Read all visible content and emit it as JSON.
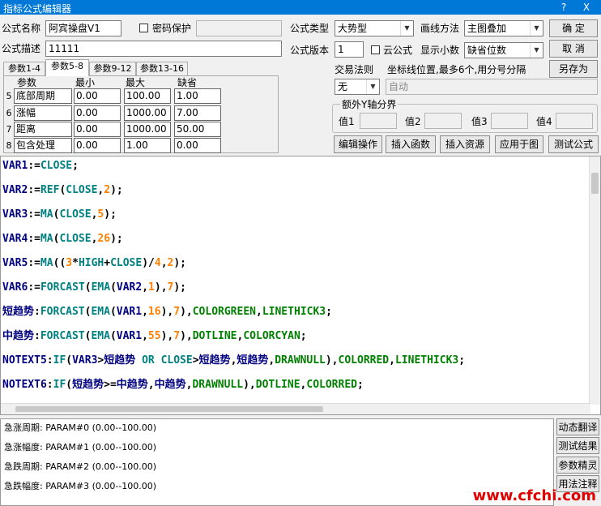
{
  "window": {
    "title": "指标公式编辑器",
    "help_btn": "?",
    "close_btn": "X"
  },
  "form": {
    "name_label": "公式名称",
    "name_value": "阿宾操盘V1",
    "password_label": "密码保护",
    "desc_label": "公式描述",
    "desc_value": "11111",
    "type_label": "公式类型",
    "type_value": "大势型",
    "draw_label": "画线方法",
    "draw_value": "主图叠加",
    "version_label": "公式版本",
    "version_value": "1",
    "cloud_label": "云公式",
    "decimals_label": "显示小数",
    "decimals_value": "缺省位数",
    "trade_label": "交易法则",
    "trade_value": "无",
    "axis_hint": "坐标线位置,最多6个,用分号分隔",
    "axis_value": "自动",
    "extra_y_label": "额外Y轴分界",
    "val1": "值1",
    "val2": "值2",
    "val3": "值3",
    "val4": "值4"
  },
  "buttons": {
    "ok": "确  定",
    "cancel": "取  消",
    "save_as": "另存为",
    "edit_ops": "编辑操作",
    "insert_func": "插入函数",
    "insert_res": "插入资源",
    "apply_chart": "应用于图",
    "test_formula": "测试公式",
    "dyn_translate": "动态翻译",
    "test_result": "测试结果",
    "param_wizard": "参数精灵",
    "usage_notes": "用法注释"
  },
  "tabs": [
    "参数1-4",
    "参数5-8",
    "参数9-12",
    "参数13-16"
  ],
  "params": {
    "headers": [
      "参数",
      "最小",
      "最大",
      "缺省"
    ],
    "rows": [
      {
        "no": "5",
        "name": "底部周期",
        "min": "0.00",
        "max": "100.00",
        "def": "1.00"
      },
      {
        "no": "6",
        "name": "涨幅",
        "min": "0.00",
        "max": "1000.00",
        "def": "7.00"
      },
      {
        "no": "7",
        "name": "距离",
        "min": "0.00",
        "max": "1000.00",
        "def": "50.00"
      },
      {
        "no": "8",
        "name": "包含处理",
        "min": "0.00",
        "max": "1.00",
        "def": "0.00"
      }
    ]
  },
  "code_lines": [
    "VAR1:=CLOSE;",
    "VAR2:=REF(CLOSE,2);",
    "VAR3:=MA(CLOSE,5);",
    "VAR4:=MA(CLOSE,26);",
    "VAR5:=MA((3*HIGH+CLOSE)/4,2);",
    "VAR6:=FORCAST(EMA(VAR2,1),7);",
    "短趋势:FORCAST(EMA(VAR1,16),7),COLORGREEN,LINETHICK3;",
    "中趋势:FORCAST(EMA(VAR1,55),7),DOTLINE,COLORCYAN;",
    "NOTEXT5:IF(VAR3>短趋势 OR CLOSE>短趋势,短趋势,DRAWNULL),COLORRED,LINETHICK3;",
    "NOTEXT6:IF(短趋势>=中趋势,中趋势,DRAWNULL),DOTLINE,COLORRED;"
  ],
  "help_lines": [
    "急涨周期: PARAM#0 (0.00--100.00)",
    "急涨幅度: PARAM#1 (0.00--100.00)",
    "急跌周期: PARAM#2 (0.00--100.00)",
    "急跌幅度: PARAM#3 (0.00--100.00)"
  ],
  "watermark": "www.cfchi.com"
}
